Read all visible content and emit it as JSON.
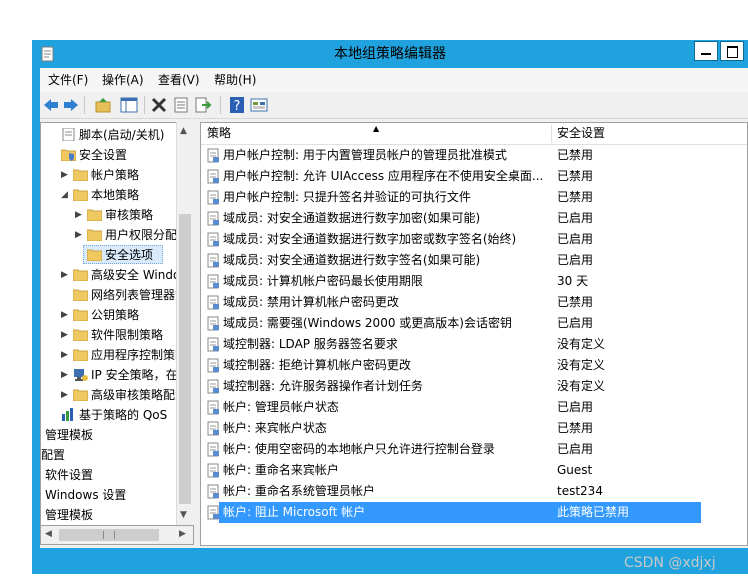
{
  "window": {
    "title": "本地组策略编辑器"
  },
  "menu": [
    {
      "label": "文件(F)"
    },
    {
      "label": "操作(A)"
    },
    {
      "label": "查看(V)"
    },
    {
      "label": "帮助(H)"
    }
  ],
  "toolbar_icons": [
    "back-icon",
    "forward-icon",
    "up-folder-icon",
    "show-tree-icon",
    "delete-icon",
    "properties-icon",
    "export-icon",
    "help-icon",
    "console-icon"
  ],
  "tree": [
    {
      "label": "脚本(启动/关机)",
      "indent": 0,
      "arrow": "",
      "icon": "script"
    },
    {
      "label": "安全设置",
      "indent": 0,
      "arrow": "",
      "icon": "shield"
    },
    {
      "label": "帐户策略",
      "indent": 1,
      "arrow": "▶",
      "icon": "folder"
    },
    {
      "label": "本地策略",
      "indent": 1,
      "arrow": "◢",
      "icon": "folder"
    },
    {
      "label": "审核策略",
      "indent": 2,
      "arrow": "▶",
      "icon": "folder"
    },
    {
      "label": "用户权限分配",
      "indent": 2,
      "arrow": "▶",
      "icon": "folder"
    },
    {
      "label": "安全选项",
      "indent": 2,
      "arrow": "",
      "icon": "folder",
      "selected": true
    },
    {
      "label": "高级安全 Window",
      "indent": 1,
      "arrow": "▶",
      "icon": "folder"
    },
    {
      "label": "网络列表管理器策",
      "indent": 1,
      "arrow": "",
      "icon": "folder"
    },
    {
      "label": "公钥策略",
      "indent": 1,
      "arrow": "▶",
      "icon": "folder"
    },
    {
      "label": "软件限制策略",
      "indent": 1,
      "arrow": "▶",
      "icon": "folder"
    },
    {
      "label": "应用程序控制策略",
      "indent": 1,
      "arrow": "▶",
      "icon": "folder"
    },
    {
      "label": "IP 安全策略，在 z",
      "indent": 1,
      "arrow": "▶",
      "icon": "ipsec"
    },
    {
      "label": "高级审核策略配置",
      "indent": 1,
      "arrow": "▶",
      "icon": "folder"
    },
    {
      "label": "基于策略的 QoS",
      "indent": 0,
      "arrow": "",
      "icon": "chart"
    },
    {
      "label": "管理模板",
      "indent": -1,
      "arrow": "",
      "icon": ""
    },
    {
      "label": "配置",
      "indent": -2,
      "arrow": "",
      "icon": ""
    },
    {
      "label": "软件设置",
      "indent": -1,
      "arrow": "",
      "icon": ""
    },
    {
      "label": "Windows 设置",
      "indent": -1,
      "arrow": "",
      "icon": ""
    },
    {
      "label": "管理模板",
      "indent": -1,
      "arrow": "",
      "icon": ""
    }
  ],
  "list": {
    "columns": {
      "policy": "策略",
      "setting": "安全设置"
    },
    "rows": [
      {
        "policy": "用户帐户控制: 用于内置管理员帐户的管理员批准模式",
        "setting": "已禁用"
      },
      {
        "policy": "用户帐户控制: 允许 UIAccess 应用程序在不使用安全桌面...",
        "setting": "已禁用"
      },
      {
        "policy": "用户帐户控制: 只提升签名并验证的可执行文件",
        "setting": "已禁用"
      },
      {
        "policy": "域成员: 对安全通道数据进行数字加密(如果可能)",
        "setting": "已启用"
      },
      {
        "policy": "域成员: 对安全通道数据进行数字加密或数字签名(始终)",
        "setting": "已启用"
      },
      {
        "policy": "域成员: 对安全通道数据进行数字签名(如果可能)",
        "setting": "已启用"
      },
      {
        "policy": "域成员: 计算机帐户密码最长使用期限",
        "setting": "30 天"
      },
      {
        "policy": "域成员: 禁用计算机帐户密码更改",
        "setting": "已禁用"
      },
      {
        "policy": "域成员: 需要强(Windows 2000 或更高版本)会话密钥",
        "setting": "已启用"
      },
      {
        "policy": "域控制器: LDAP 服务器签名要求",
        "setting": "没有定义"
      },
      {
        "policy": "域控制器: 拒绝计算机帐户密码更改",
        "setting": "没有定义"
      },
      {
        "policy": "域控制器: 允许服务器操作者计划任务",
        "setting": "没有定义"
      },
      {
        "policy": "帐户: 管理员帐户状态",
        "setting": "已启用"
      },
      {
        "policy": "帐户: 来宾帐户状态",
        "setting": "已禁用"
      },
      {
        "policy": "帐户: 使用空密码的本地帐户只允许进行控制台登录",
        "setting": "已启用"
      },
      {
        "policy": "帐户: 重命名来宾帐户",
        "setting": "Guest"
      },
      {
        "policy": "帐户: 重命名系统管理员帐户",
        "setting": "test234"
      },
      {
        "policy": "帐户: 阻止 Microsoft 帐户",
        "setting": "此策略已禁用",
        "selected": true
      }
    ]
  },
  "watermark": "CSDN @xdjxj",
  "colors": {
    "titlebar": "#1fa2dd",
    "selection": "#3399ff"
  }
}
